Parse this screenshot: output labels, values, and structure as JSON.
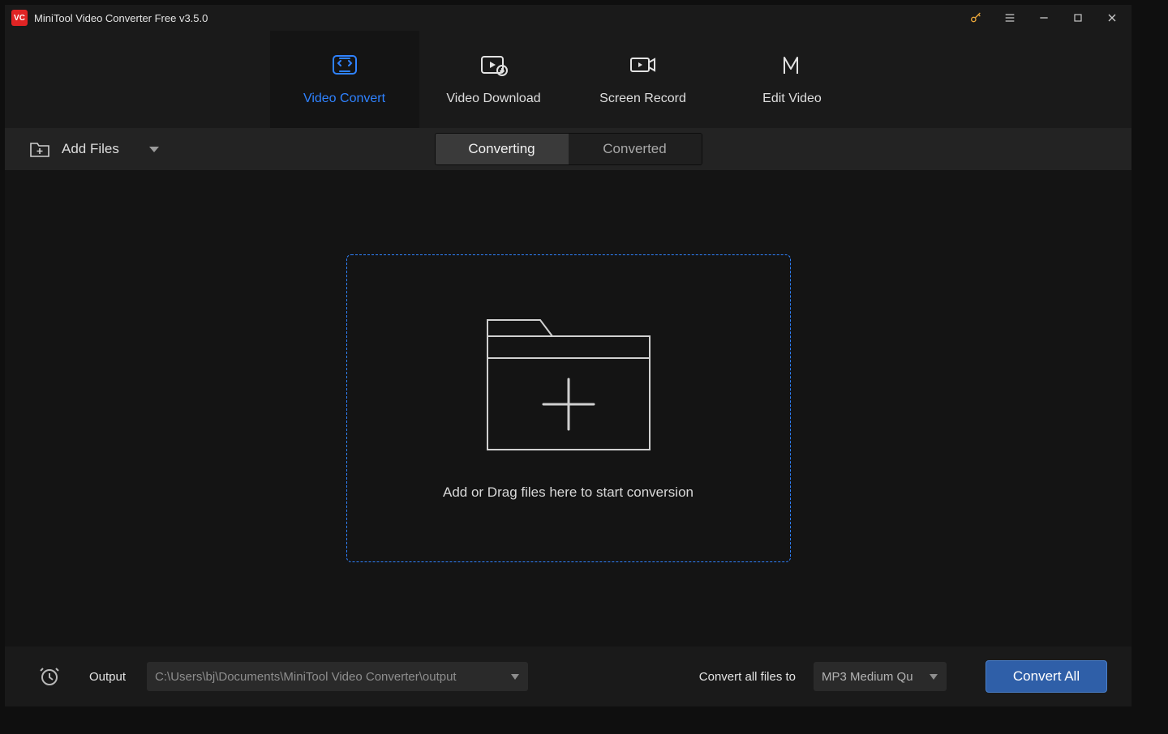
{
  "titlebar": {
    "app_logo_text": "VC",
    "title": "MiniTool Video Converter Free v3.5.0"
  },
  "nav": {
    "items": [
      {
        "label": "Video Convert"
      },
      {
        "label": "Video Download"
      },
      {
        "label": "Screen Record"
      },
      {
        "label": "Edit Video"
      }
    ]
  },
  "toolbar": {
    "add_files_label": "Add Files",
    "segment_converting": "Converting",
    "segment_converted": "Converted"
  },
  "dropzone": {
    "text": "Add or Drag files here to start conversion"
  },
  "footer": {
    "output_label": "Output",
    "output_path": "C:\\Users\\bj\\Documents\\MiniTool Video Converter\\output",
    "convert_all_label": "Convert all files to",
    "format_selected": "MP3 Medium Qu",
    "convert_all_btn": "Convert All"
  }
}
